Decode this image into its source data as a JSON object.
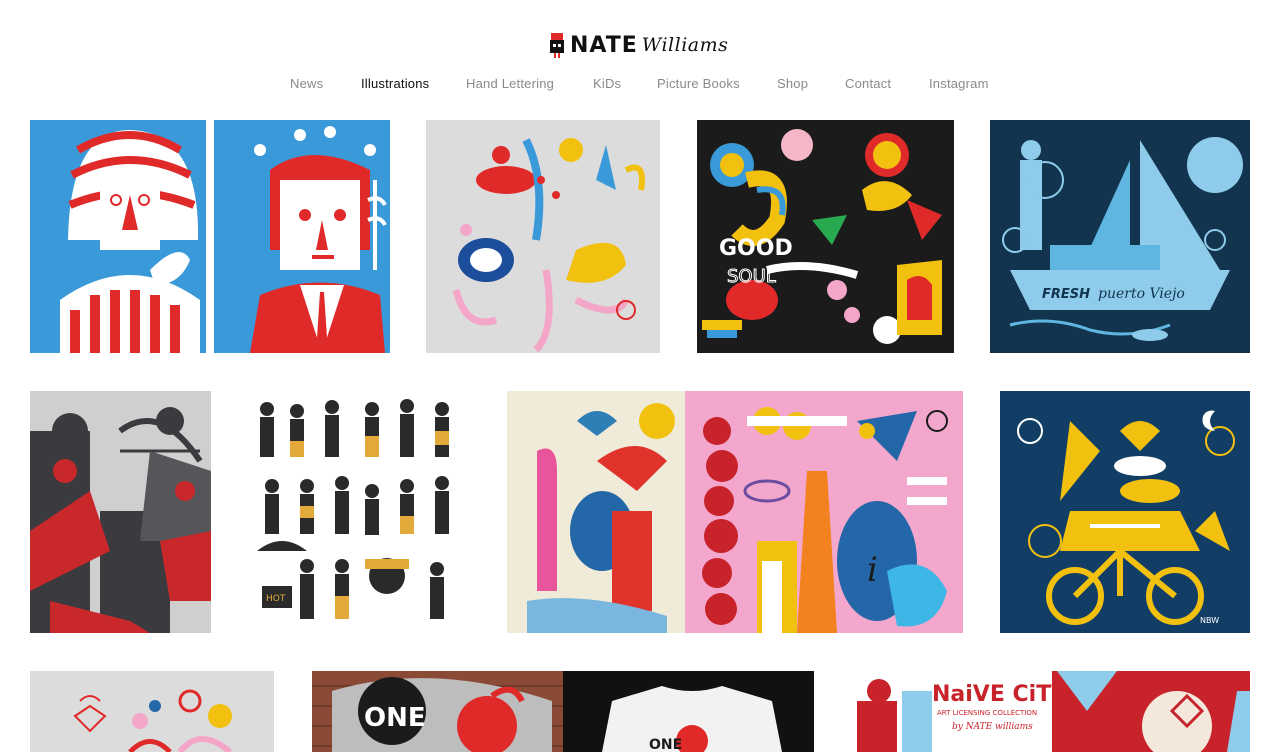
{
  "site": {
    "logo_bold": "NATE",
    "logo_script": "Williams"
  },
  "nav": {
    "items": [
      {
        "label": "News",
        "active": false
      },
      {
        "label": "Illustrations",
        "active": true
      },
      {
        "label": "Hand Lettering",
        "active": false
      },
      {
        "label": "KiDs",
        "active": false
      },
      {
        "label": "Picture Books",
        "active": false
      },
      {
        "label": "Shop",
        "active": false
      },
      {
        "label": "Contact",
        "active": false
      },
      {
        "label": "Instagram",
        "active": false
      }
    ]
  },
  "gallery": {
    "good_soul": {
      "line1": "GOOD",
      "line2": "SOUL"
    },
    "fresh": {
      "word1": "FRESH",
      "word2": "puerto Viejo"
    },
    "hot_cart": {
      "label": "HOT"
    },
    "naive_city": {
      "title": "NaiVE CiTY",
      "subtitle": "ART LICENSING COLLECTION",
      "byline": "by NATE williams"
    },
    "signature": "NBW"
  },
  "colors": {
    "red": "#e02a2a",
    "blue": "#3a9ad9",
    "navy": "#0f3d63",
    "yellow": "#f2c10f",
    "pink": "#f3a6c8",
    "black": "#1b1b1b"
  }
}
